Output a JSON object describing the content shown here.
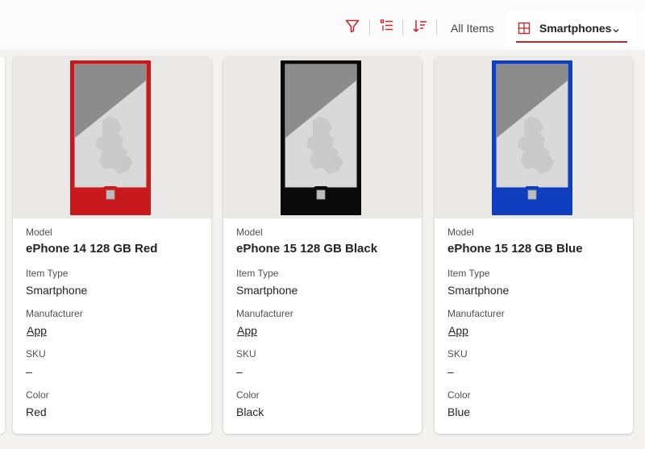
{
  "toolbar": {
    "filter_icon": "filter-icon",
    "group_icon": "list-group-icon",
    "sort_icon": "sort-icon",
    "all_items_label": "All Items",
    "active_view_icon": "table-grid-icon",
    "active_view_label": "Smartphones",
    "chevron_icon": "chevron-down-icon",
    "accent_color": "#c4262e"
  },
  "labels": {
    "model": "Model",
    "item_type": "Item Type",
    "manufacturer": "Manufacturer",
    "sku": "SKU",
    "color": "Color"
  },
  "items": [
    {
      "model": "ePhone 14 128 GB Red",
      "item_type": "Smartphone",
      "manufacturer": "App",
      "sku": "–",
      "color": "Red",
      "phone_color": "#c8191d"
    },
    {
      "model": "ePhone 15 128 GB Black",
      "item_type": "Smartphone",
      "manufacturer": "App",
      "sku": "–",
      "color": "Black",
      "phone_color": "#0a0a0a"
    },
    {
      "model": "ePhone 15 128 GB Blue",
      "item_type": "Smartphone",
      "manufacturer": "App",
      "sku": "–",
      "color": "Blue",
      "phone_color": "#0f3fbf"
    }
  ]
}
